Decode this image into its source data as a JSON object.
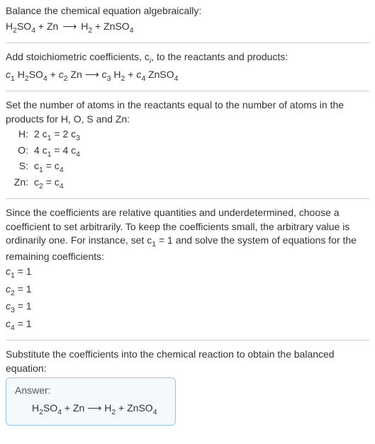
{
  "title": "Balance the chemical equation algebraically:",
  "unbalanced": {
    "lhs": [
      "H",
      "2",
      "SO",
      "4",
      " + Zn"
    ],
    "arrow": "⟶",
    "rhs": [
      "H",
      "2",
      " + ZnSO",
      "4"
    ]
  },
  "stoich_intro": "Add stoichiometric coefficients, c",
  "stoich_intro2": ", to the reactants and products:",
  "with_c": {
    "c1": "c",
    "s1": "1",
    "t1": " H",
    "t1s": "2",
    "t1b": "SO",
    "t1bs": "4",
    "plus1": " + ",
    "c2": "c",
    "s2": "2",
    "t2": " Zn",
    "arrow": " ⟶ ",
    "c3": "c",
    "s3": "3",
    "t3": " H",
    "t3s": "2",
    "plus2": " + ",
    "c4": "c",
    "s4": "4",
    "t4": " ZnSO",
    "t4s": "4"
  },
  "atoms_intro": "Set the number of atoms in the reactants equal to the number of atoms in the products for H, O, S and Zn:",
  "rows": [
    {
      "el": "H:",
      "eq_l1": "2 c",
      "eq_s1": "1",
      "eq_m": " = 2 c",
      "eq_s2": "3"
    },
    {
      "el": "O:",
      "eq_l1": "4 c",
      "eq_s1": "1",
      "eq_m": " = 4 c",
      "eq_s2": "4"
    },
    {
      "el": "S:",
      "eq_l1": "c",
      "eq_s1": "1",
      "eq_m": " = c",
      "eq_s2": "4"
    },
    {
      "el": "Zn:",
      "eq_l1": "c",
      "eq_s1": "2",
      "eq_m": " = c",
      "eq_s2": "4"
    }
  ],
  "underdet1": "Since the coefficients are relative quantities and underdetermined, choose a coefficient to set arbitrarily. To keep the coefficients small, the arbitrary value is ordinarily one. For instance, set c",
  "underdet_sub": "1",
  "underdet2": " = 1 and solve the system of equations for the remaining coefficients:",
  "solutions": [
    {
      "c": "c",
      "i": "1",
      "v": " = 1"
    },
    {
      "c": "c",
      "i": "2",
      "v": " = 1"
    },
    {
      "c": "c",
      "i": "3",
      "v": " = 1"
    },
    {
      "c": "c",
      "i": "4",
      "v": " = 1"
    }
  ],
  "subst": "Substitute the coefficients into the chemical reaction to obtain the balanced equation:",
  "answer_label": "Answer:",
  "balanced": {
    "lhs_a": "H",
    "lhs_as": "2",
    "lhs_b": "SO",
    "lhs_bs": "4",
    "plus1": " + Zn",
    "arrow": " ⟶ ",
    "rhs_a": "H",
    "rhs_as": "2",
    "plus2": " + ZnSO",
    "rhs_bs": "4"
  }
}
